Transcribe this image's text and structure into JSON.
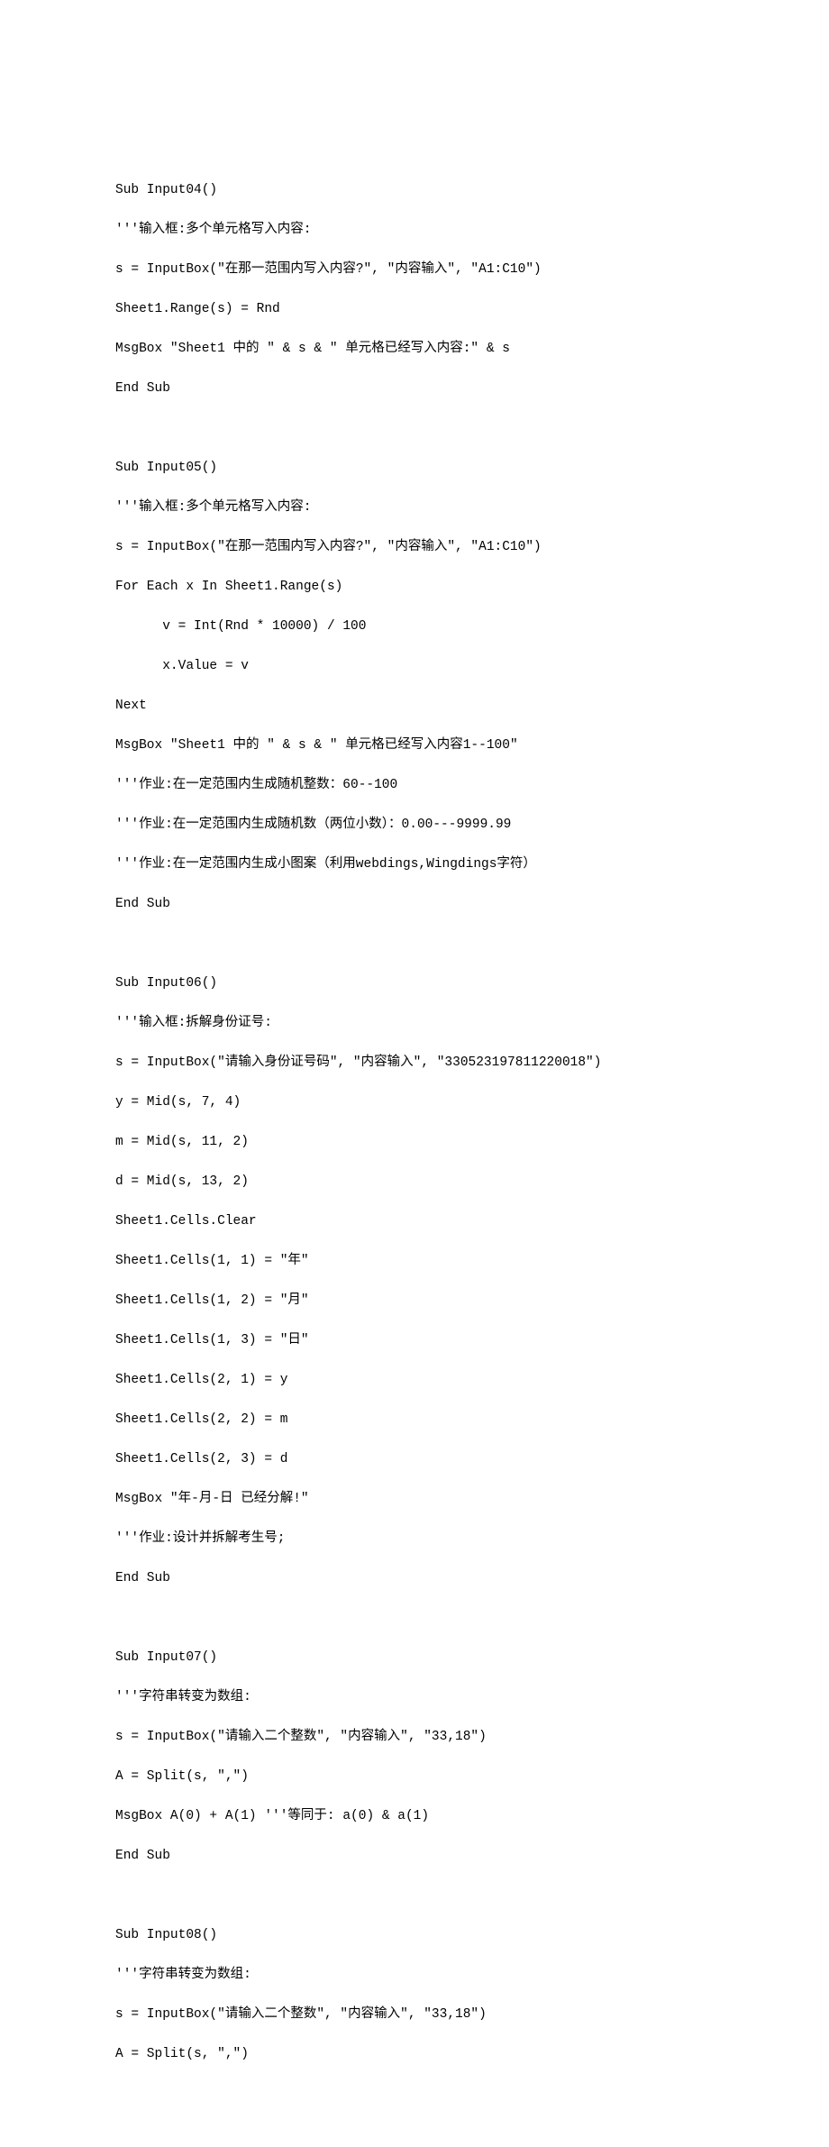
{
  "code": {
    "lines": [
      "Sub Input04()",
      "'''输入框:多个单元格写入内容:",
      "s = InputBox(\"在那一范围内写入内容?\", \"内容输入\", \"A1:C10\")",
      "Sheet1.Range(s) = Rnd",
      "MsgBox \"Sheet1 中的 \" & s & \" 单元格已经写入内容:\" & s",
      "End Sub",
      "",
      "Sub Input05()",
      "'''输入框:多个单元格写入内容:",
      "s = InputBox(\"在那一范围内写入内容?\", \"内容输入\", \"A1:C10\")",
      "For Each x In Sheet1.Range(s)",
      "      v = Int(Rnd * 10000) / 100",
      "      x.Value = v",
      "Next",
      "MsgBox \"Sheet1 中的 \" & s & \" 单元格已经写入内容1--100\"",
      "'''作业:在一定范围内生成随机整数：60--100",
      "'''作业:在一定范围内生成随机数（两位小数）：0.00---9999.99",
      "'''作业:在一定范围内生成小图案（利用webdings,Wingdings字符）",
      "End Sub",
      "",
      "Sub Input06()",
      "'''输入框:拆解身份证号:",
      "s = InputBox(\"请输入身份证号码\", \"内容输入\", \"330523197811220018\")",
      "y = Mid(s, 7, 4)",
      "m = Mid(s, 11, 2)",
      "d = Mid(s, 13, 2)",
      "Sheet1.Cells.Clear",
      "Sheet1.Cells(1, 1) = \"年\"",
      "Sheet1.Cells(1, 2) = \"月\"",
      "Sheet1.Cells(1, 3) = \"日\"",
      "Sheet1.Cells(2, 1) = y",
      "Sheet1.Cells(2, 2) = m",
      "Sheet1.Cells(2, 3) = d",
      "MsgBox \"年-月-日 已经分解!\"",
      "'''作业:设计并拆解考生号;",
      "End Sub",
      "",
      "Sub Input07()",
      "'''字符串转变为数组:",
      "s = InputBox(\"请输入二个整数\", \"内容输入\", \"33,18\")",
      "A = Split(s, \",\")",
      "MsgBox A(0) + A(1) '''等同于: a(0) & a(1)",
      "End Sub",
      "",
      "Sub Input08()",
      "'''字符串转变为数组:",
      "s = InputBox(\"请输入二个整数\", \"内容输入\", \"33,18\")",
      "A = Split(s, \",\")"
    ]
  }
}
